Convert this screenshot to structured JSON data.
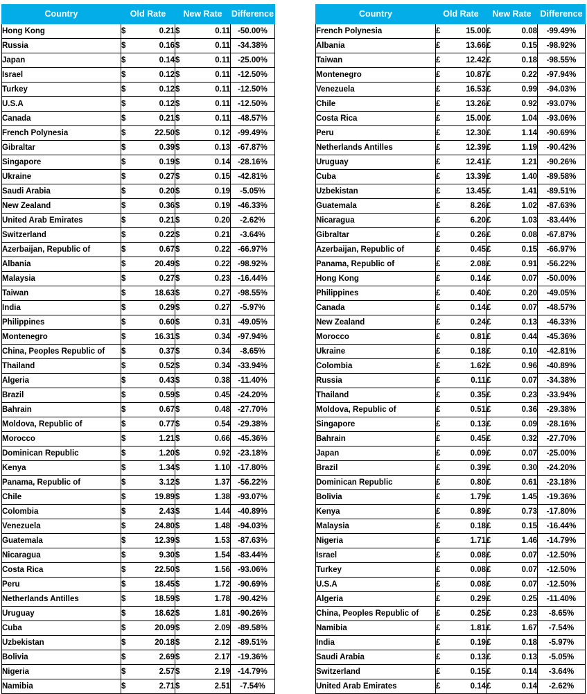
{
  "theme": {
    "header_bg": "#02ade8",
    "header_text": "#ffffff",
    "grid_line": "#000000",
    "page_bg": "#ffffff",
    "body_text": "#000000"
  },
  "tables": [
    {
      "id": "usd",
      "currency_symbol": "$",
      "columns": [
        "Country",
        "Old Rate",
        "New Rate",
        "Difference"
      ],
      "rows": [
        [
          "Hong Kong",
          "0.21",
          "0.11",
          "-50.00%"
        ],
        [
          "Russia",
          "0.16",
          "0.11",
          "-34.38%"
        ],
        [
          "Japan",
          "0.14",
          "0.11",
          "-25.00%"
        ],
        [
          "Israel",
          "0.12",
          "0.11",
          "-12.50%"
        ],
        [
          "Turkey",
          "0.12",
          "0.11",
          "-12.50%"
        ],
        [
          "U.S.A",
          "0.12",
          "0.11",
          "-12.50%"
        ],
        [
          "Canada",
          "0.21",
          "0.11",
          "-48.57%"
        ],
        [
          "French Polynesia",
          "22.50",
          "0.12",
          "-99.49%"
        ],
        [
          "Gibraltar",
          "0.39",
          "0.13",
          "-67.87%"
        ],
        [
          "Singapore",
          "0.19",
          "0.14",
          "-28.16%"
        ],
        [
          "Ukraine",
          "0.27",
          "0.15",
          "-42.81%"
        ],
        [
          "Saudi Arabia",
          "0.20",
          "0.19",
          "-5.05%"
        ],
        [
          "New Zealand",
          "0.36",
          "0.19",
          "-46.33%"
        ],
        [
          "United Arab Emirates",
          "0.21",
          "0.20",
          "-2.62%"
        ],
        [
          "Switzerland",
          "0.22",
          "0.21",
          "-3.64%"
        ],
        [
          "Azerbaijan, Republic of",
          "0.67",
          "0.22",
          "-66.97%"
        ],
        [
          "Albania",
          "20.49",
          "0.22",
          "-98.92%"
        ],
        [
          "Malaysia",
          "0.27",
          "0.23",
          "-16.44%"
        ],
        [
          "Taiwan",
          "18.63",
          "0.27",
          "-98.55%"
        ],
        [
          "India",
          "0.29",
          "0.27",
          "-5.97%"
        ],
        [
          "Philippines",
          "0.60",
          "0.31",
          "-49.05%"
        ],
        [
          "Montenegro",
          "16.31",
          "0.34",
          "-97.94%"
        ],
        [
          "China, Peoples Republic of",
          "0.37",
          "0.34",
          "-8.65%"
        ],
        [
          "Thailand",
          "0.52",
          "0.34",
          "-33.94%"
        ],
        [
          "Algeria",
          "0.43",
          "0.38",
          "-11.40%"
        ],
        [
          "Brazil",
          "0.59",
          "0.45",
          "-24.20%"
        ],
        [
          "Bahrain",
          "0.67",
          "0.48",
          "-27.70%"
        ],
        [
          "Moldova, Republic of",
          "0.77",
          "0.54",
          "-29.38%"
        ],
        [
          "Morocco",
          "1.21",
          "0.66",
          "-45.36%"
        ],
        [
          "Dominican Republic",
          "1.20",
          "0.92",
          "-23.18%"
        ],
        [
          "Kenya",
          "1.34",
          "1.10",
          "-17.80%"
        ],
        [
          "Panama, Republic of",
          "3.12",
          "1.37",
          "-56.22%"
        ],
        [
          "Chile",
          "19.89",
          "1.38",
          "-93.07%"
        ],
        [
          "Colombia",
          "2.43",
          "1.44",
          "-40.89%"
        ],
        [
          "Venezuela",
          "24.80",
          "1.48",
          "-94.03%"
        ],
        [
          "Guatemala",
          "12.39",
          "1.53",
          "-87.63%"
        ],
        [
          "Nicaragua",
          "9.30",
          "1.54",
          "-83.44%"
        ],
        [
          "Costa Rica",
          "22.50",
          "1.56",
          "-93.06%"
        ],
        [
          "Peru",
          "18.45",
          "1.72",
          "-90.69%"
        ],
        [
          "Netherlands Antilles",
          "18.59",
          "1.78",
          "-90.42%"
        ],
        [
          "Uruguay",
          "18.62",
          "1.81",
          "-90.26%"
        ],
        [
          "Cuba",
          "20.09",
          "2.09",
          "-89.58%"
        ],
        [
          "Uzbekistan",
          "20.18",
          "2.12",
          "-89.51%"
        ],
        [
          "Bolivia",
          "2.69",
          "2.17",
          "-19.36%"
        ],
        [
          "Nigeria",
          "2.57",
          "2.19",
          "-14.79%"
        ],
        [
          "Namibia",
          "2.71",
          "2.51",
          "-7.54%"
        ]
      ]
    },
    {
      "id": "gbp",
      "currency_symbol": "£",
      "columns": [
        "Country",
        "Old Rate",
        "New Rate",
        "Difference"
      ],
      "rows": [
        [
          "French Polynesia",
          "15.00",
          "0.08",
          "-99.49%"
        ],
        [
          "Albania",
          "13.66",
          "0.15",
          "-98.92%"
        ],
        [
          "Taiwan",
          "12.42",
          "0.18",
          "-98.55%"
        ],
        [
          "Montenegro",
          "10.87",
          "0.22",
          "-97.94%"
        ],
        [
          "Venezuela",
          "16.53",
          "0.99",
          "-94.03%"
        ],
        [
          "Chile",
          "13.26",
          "0.92",
          "-93.07%"
        ],
        [
          "Costa Rica",
          "15.00",
          "1.04",
          "-93.06%"
        ],
        [
          "Peru",
          "12.30",
          "1.14",
          "-90.69%"
        ],
        [
          "Netherlands Antilles",
          "12.39",
          "1.19",
          "-90.42%"
        ],
        [
          "Uruguay",
          "12.41",
          "1.21",
          "-90.26%"
        ],
        [
          "Cuba",
          "13.39",
          "1.40",
          "-89.58%"
        ],
        [
          "Uzbekistan",
          "13.45",
          "1.41",
          "-89.51%"
        ],
        [
          "Guatemala",
          "8.26",
          "1.02",
          "-87.63%"
        ],
        [
          "Nicaragua",
          "6.20",
          "1.03",
          "-83.44%"
        ],
        [
          "Gibraltar",
          "0.26",
          "0.08",
          "-67.87%"
        ],
        [
          "Azerbaijan, Republic of",
          "0.45",
          "0.15",
          "-66.97%"
        ],
        [
          "Panama, Republic of",
          "2.08",
          "0.91",
          "-56.22%"
        ],
        [
          "Hong Kong",
          "0.14",
          "0.07",
          "-50.00%"
        ],
        [
          "Philippines",
          "0.40",
          "0.20",
          "-49.05%"
        ],
        [
          "Canada",
          "0.14",
          "0.07",
          "-48.57%"
        ],
        [
          "New Zealand",
          "0.24",
          "0.13",
          "-46.33%"
        ],
        [
          "Morocco",
          "0.81",
          "0.44",
          "-45.36%"
        ],
        [
          "Ukraine",
          "0.18",
          "0.10",
          "-42.81%"
        ],
        [
          "Colombia",
          "1.62",
          "0.96",
          "-40.89%"
        ],
        [
          "Russia",
          "0.11",
          "0.07",
          "-34.38%"
        ],
        [
          "Thailand",
          "0.35",
          "0.23",
          "-33.94%"
        ],
        [
          "Moldova, Republic of",
          "0.51",
          "0.36",
          "-29.38%"
        ],
        [
          "Singapore",
          "0.13",
          "0.09",
          "-28.16%"
        ],
        [
          "Bahrain",
          "0.45",
          "0.32",
          "-27.70%"
        ],
        [
          "Japan",
          "0.09",
          "0.07",
          "-25.00%"
        ],
        [
          "Brazil",
          "0.39",
          "0.30",
          "-24.20%"
        ],
        [
          "Dominican Republic",
          "0.80",
          "0.61",
          "-23.18%"
        ],
        [
          "Bolivia",
          "1.79",
          "1.45",
          "-19.36%"
        ],
        [
          "Kenya",
          "0.89",
          "0.73",
          "-17.80%"
        ],
        [
          "Malaysia",
          "0.18",
          "0.15",
          "-16.44%"
        ],
        [
          "Nigeria",
          "1.71",
          "1.46",
          "-14.79%"
        ],
        [
          "Israel",
          "0.08",
          "0.07",
          "-12.50%"
        ],
        [
          "Turkey",
          "0.08",
          "0.07",
          "-12.50%"
        ],
        [
          "U.S.A",
          "0.08",
          "0.07",
          "-12.50%"
        ],
        [
          "Algeria",
          "0.29",
          "0.25",
          "-11.40%"
        ],
        [
          "China, Peoples Republic of",
          "0.25",
          "0.23",
          "-8.65%"
        ],
        [
          "Namibia",
          "1.81",
          "1.67",
          "-7.54%"
        ],
        [
          "India",
          "0.19",
          "0.18",
          "-5.97%"
        ],
        [
          "Saudi Arabia",
          "0.13",
          "0.13",
          "-5.05%"
        ],
        [
          "Switzerland",
          "0.15",
          "0.14",
          "-3.64%"
        ],
        [
          "United Arab Emirates",
          "0.14",
          "0.14",
          "-2.62%"
        ]
      ]
    }
  ]
}
